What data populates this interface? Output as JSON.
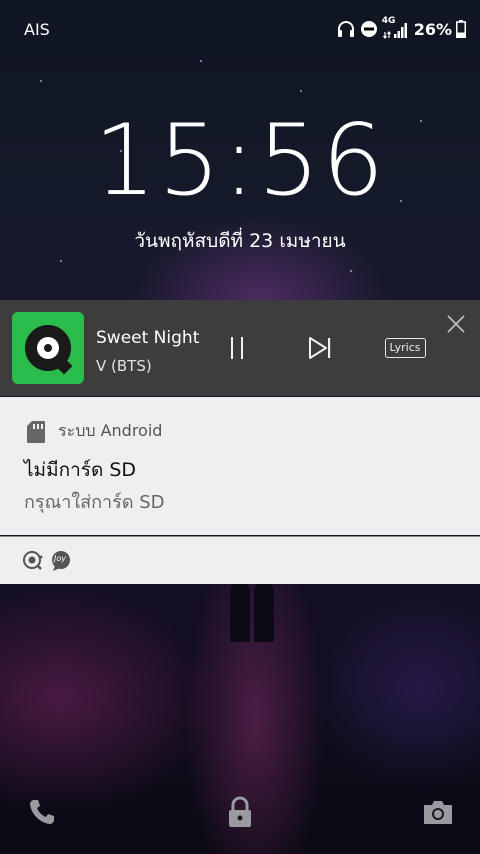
{
  "status_bar": {
    "carrier": "AIS",
    "network": "4G",
    "battery": "26%",
    "icons": [
      "headphones-icon",
      "do-not-disturb-icon",
      "signal-icon",
      "battery-icon"
    ]
  },
  "lockscreen": {
    "time": "15:56",
    "date": "วันพฤหัสบดีที่ 23 เมษายน"
  },
  "media_player": {
    "app_icon": "joox-app-icon",
    "song_title": "Sweet Night",
    "artist": "V (BTS)",
    "lyrics_label": "Lyrics",
    "controls": [
      "pause-icon",
      "next-icon",
      "lyrics-button",
      "close-icon"
    ]
  },
  "notification": {
    "app_name": "ระบบ Android",
    "title": "ไม่มีการ์ด SD",
    "body": "กรุณาใส่การ์ด SD",
    "footer_icons": [
      "joox-small-icon",
      "joy-small-icon"
    ],
    "joy_label": "Joy"
  },
  "shortcuts": [
    "phone-icon",
    "lock-icon",
    "camera-icon"
  ],
  "colors": {
    "media_bg": "#3d3d3d",
    "notification_bg": "#efeff1",
    "joox_green": "#2bbd4c"
  }
}
